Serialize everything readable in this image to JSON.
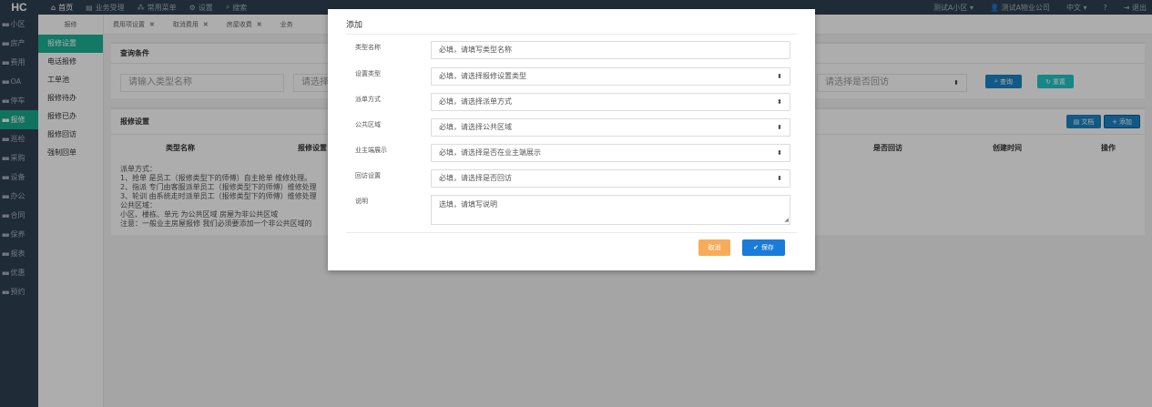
{
  "topbar": {
    "brand": "HC",
    "nav": [
      {
        "icon": "home-icon",
        "glyph": "⌂",
        "label": "首页"
      },
      {
        "icon": "business-icon",
        "glyph": "▤",
        "label": "业务受理"
      },
      {
        "icon": "menu-icon",
        "glyph": "⁂",
        "label": "常用菜单"
      },
      {
        "icon": "gear-icon",
        "glyph": "⚙",
        "label": "设置"
      },
      {
        "icon": "search-icon",
        "glyph": "⌕",
        "label": "搜索"
      }
    ],
    "community": "测试A小区",
    "company": "测试A物业公司",
    "language": "中文",
    "help": "?",
    "logout": "退出"
  },
  "sidebar": [
    "小区",
    "房产",
    "费用",
    "OA",
    "停车",
    "报修",
    "巡检",
    "采购",
    "设备",
    "办公",
    "合同",
    "保养",
    "报表",
    "优惠",
    "预约"
  ],
  "subside": {
    "header": "报修",
    "items": [
      "报修设置",
      "电话报修",
      "工单池",
      "报修待办",
      "报修已办",
      "报修回访",
      "强制回单"
    ]
  },
  "tabs": [
    "费用项设置",
    "取消费用",
    "房屋收费",
    "业务"
  ],
  "query": {
    "title": "查询条件",
    "type_name_placeholder": "请输入类型名称",
    "repair_type_placeholder": "请选择",
    "return_visit_placeholder": "请选择是否回访",
    "search_btn": "查询",
    "reset_btn": "重置"
  },
  "repair": {
    "title": "报修设置",
    "doc_btn": "文档",
    "add_btn": "添加",
    "columns": [
      "类型名称",
      "报修设置",
      "是否回访",
      "创建时间",
      "操作"
    ],
    "notes": [
      "派单方式：",
      "1、抢单 是员工（报修类型下的师傅）自主抢单 维修处理。",
      "2、指派 专门由客服派单员工（报修类型下的师傅）维修处理",
      "3、轮训 由系统走时派单员工（报修类型下的师傅）维修处理",
      "公共区域：",
      "小区、楼栋、单元 为公共区域 房屋为非公共区域",
      "注意：一般业主房屋报修 我们必须要添加一个非公共区域的"
    ]
  },
  "modal": {
    "title": "添加",
    "fields": [
      {
        "label": "类型名称",
        "placeholder": "必填，请填写类型名称",
        "select": false
      },
      {
        "label": "设置类型",
        "placeholder": "必填，请选择报修设置类型",
        "select": true
      },
      {
        "label": "派单方式",
        "placeholder": "必填，请选择派单方式",
        "select": true
      },
      {
        "label": "公共区域",
        "placeholder": "必填，请选择公共区域",
        "select": true
      },
      {
        "label": "业主端展示",
        "placeholder": "必填，请选择是否在业主端展示",
        "select": true
      },
      {
        "label": "回访设置",
        "placeholder": "必填，请选择是否回访",
        "select": true
      }
    ],
    "remark_label": "说明",
    "remark_placeholder": "选填，请填写说明",
    "cancel": "取消",
    "save": "保存"
  },
  "colors": {
    "sidebar": "#2f4050",
    "accent": "#1ab394",
    "primary": "#1c84c6",
    "cancel": "#f8ac59",
    "save": "#1a7bd8"
  }
}
